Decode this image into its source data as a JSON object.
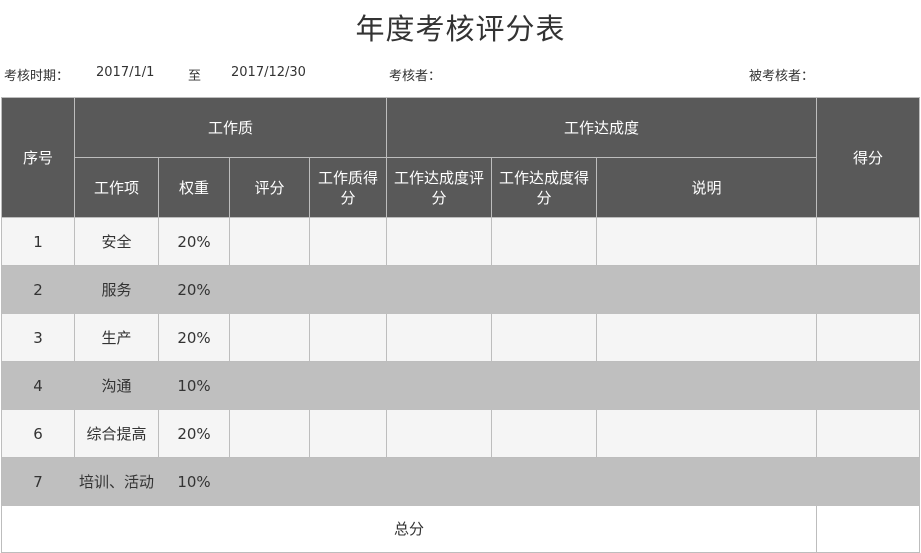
{
  "title": "年度考核评分表",
  "meta": {
    "period_label": "考核时期：",
    "start_date": "2017/1/1",
    "to_label": "至",
    "end_date": "2017/12/30",
    "assessor_label": "考核者：",
    "assessee_label": "被考核者："
  },
  "header": {
    "seq": "序号",
    "quality_group": "工作质",
    "achievement_group": "工作达成度",
    "score": "得分",
    "work_item": "工作项",
    "weight": "权重",
    "rating": "评分",
    "quality_score": "工作质得分",
    "achievement_rating": "工作达成度评分",
    "achievement_score": "工作达成度得分",
    "notes": "说明"
  },
  "rows": [
    {
      "seq": "1",
      "item": "安全",
      "weight": "20%"
    },
    {
      "seq": "2",
      "item": "服务",
      "weight": "20%"
    },
    {
      "seq": "3",
      "item": "生产",
      "weight": "20%"
    },
    {
      "seq": "4",
      "item": "沟通",
      "weight": "10%"
    },
    {
      "seq": "6",
      "item": "综合提高",
      "weight": "20%"
    },
    {
      "seq": "7",
      "item": "培训、活动",
      "weight": "10%"
    }
  ],
  "total_label": "总分",
  "colors": {
    "header_bg": "#595959",
    "header_text": "#ffffff",
    "row_light": "#f5f5f5",
    "row_dark": "#bfbfbf"
  }
}
